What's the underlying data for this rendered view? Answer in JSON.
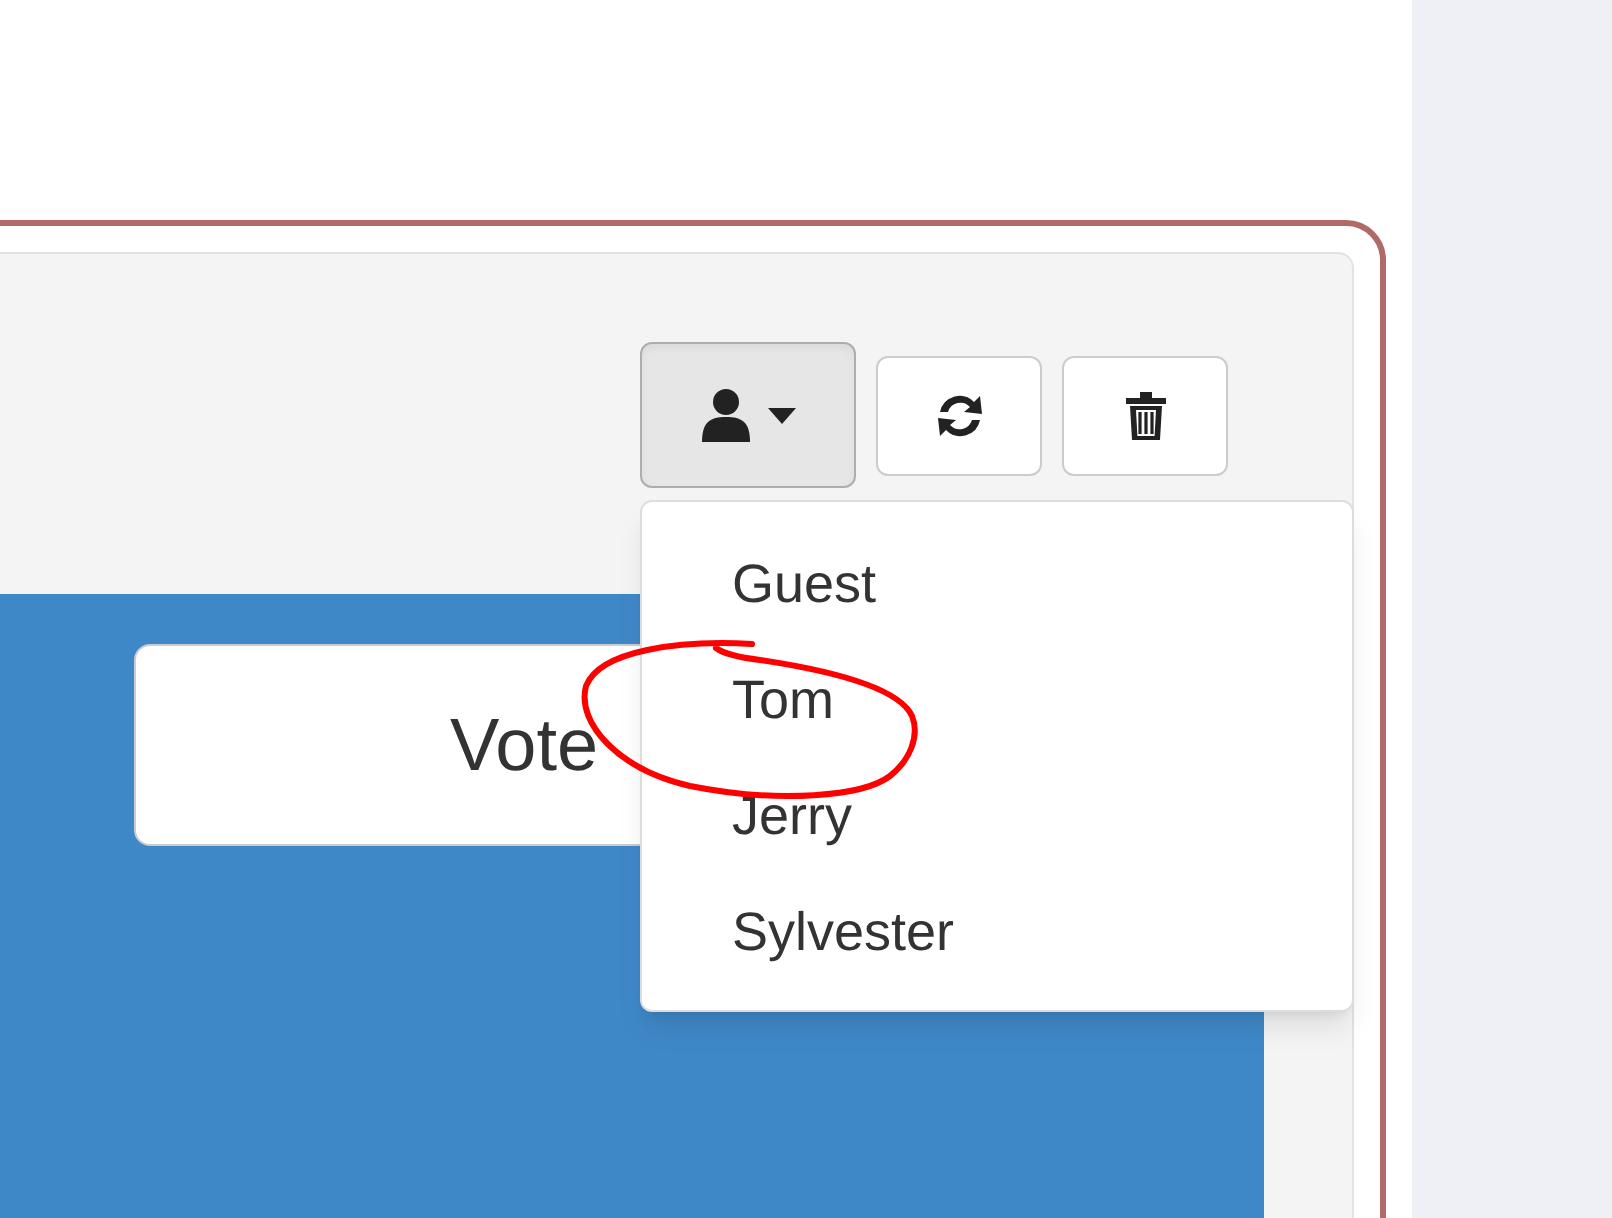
{
  "toolbar": {
    "buttons": [
      {
        "kind": "user",
        "expanded": true
      },
      {
        "kind": "refresh"
      },
      {
        "kind": "delete"
      }
    ]
  },
  "user_menu": {
    "items": [
      {
        "label": "Guest"
      },
      {
        "label": "Tom"
      },
      {
        "label": "Jerry"
      },
      {
        "label": "Sylvester"
      }
    ]
  },
  "vote_button": {
    "label": "Vote"
  }
}
